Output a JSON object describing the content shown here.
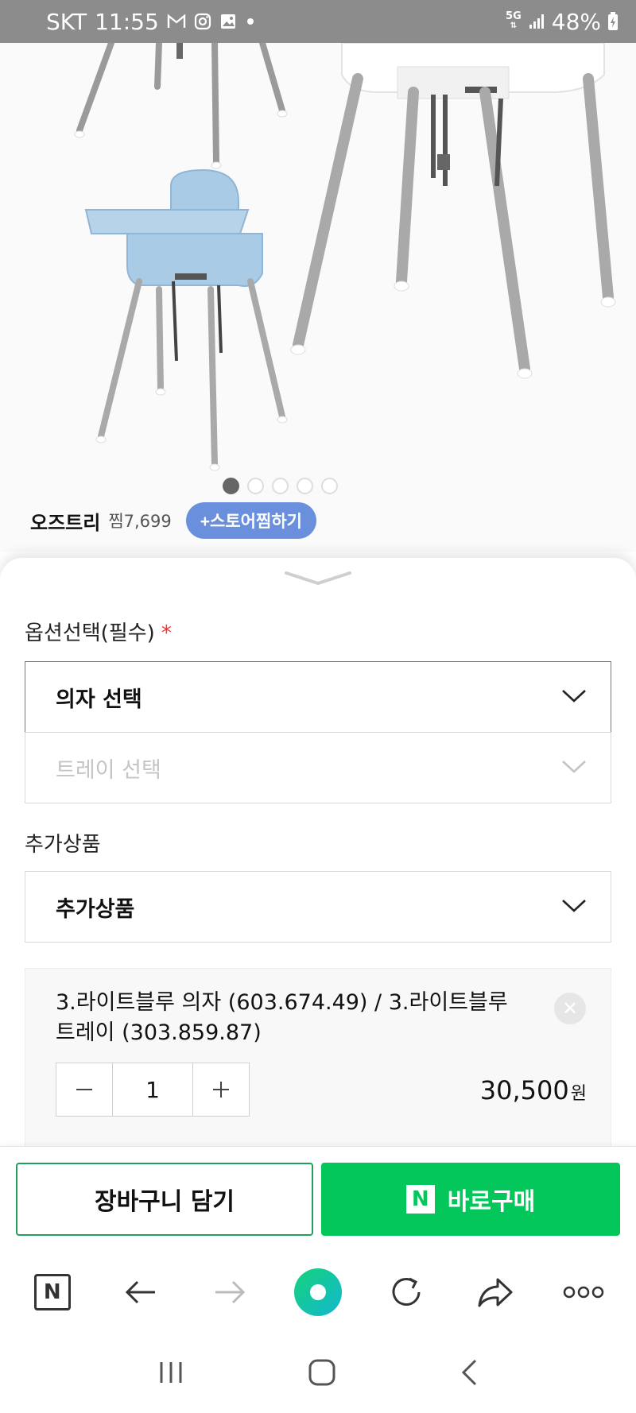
{
  "status_bar": {
    "carrier": "SKT",
    "time": "11:55",
    "network": "5G",
    "battery": "48%"
  },
  "store": {
    "name": "오즈트리",
    "likes": "찜7,699",
    "follow_button": "+스토어찜하기"
  },
  "carousel": {
    "total_dots": 5,
    "active_index": 0
  },
  "options": {
    "label": "옵션선택(필수)",
    "required_mark": "*",
    "chair_select": "의자 선택",
    "tray_select": "트레이 선택"
  },
  "addons": {
    "label": "추가상품",
    "select": "추가상품"
  },
  "selected_option": {
    "name": "3.라이트블루 의자 (603.674.49) / 3.라이트블루 트레이 (303.859.87)",
    "quantity": "1",
    "price": "30,500",
    "currency": "원"
  },
  "actions": {
    "cart": "장바구니 담기",
    "buy": "바로구매",
    "buy_badge": "N"
  },
  "browser_toolbar": {
    "home_badge": "N"
  },
  "colors": {
    "naver_green": "#03c75a",
    "store_button": "#6a8fdc",
    "required": "#e33333"
  }
}
